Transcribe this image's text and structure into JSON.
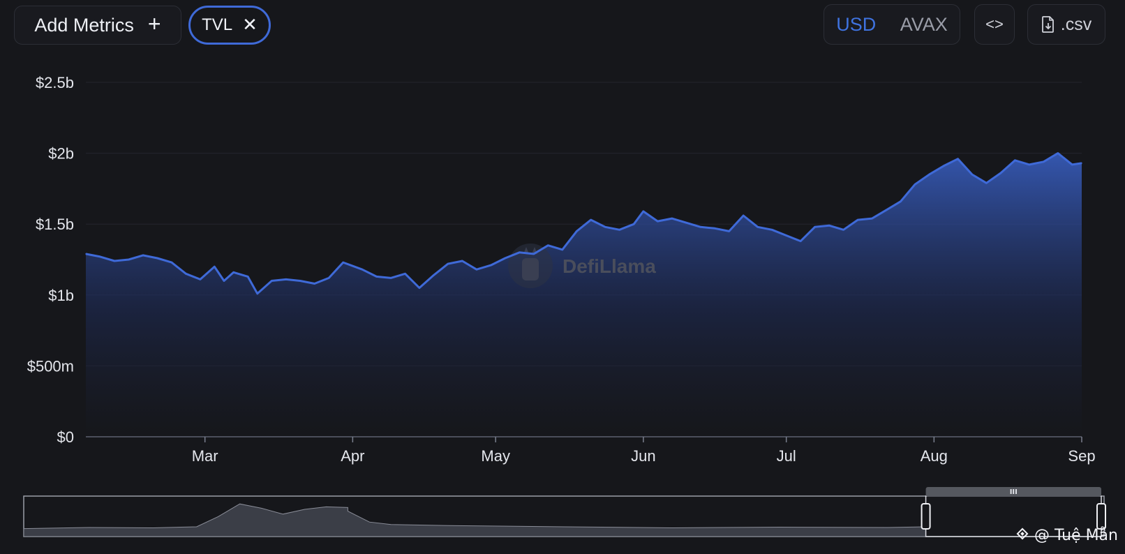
{
  "toolbar": {
    "add_metrics_label": "Add Metrics",
    "add_metrics_icon": "+",
    "metric_chip_label": "TVL",
    "metric_chip_close": "✕",
    "currency_options": [
      "USD",
      "AVAX"
    ],
    "currency_selected": "USD",
    "embed_icon": "<>",
    "csv_label": ".csv"
  },
  "watermark": "DefiLlama",
  "credit": "@ Tuệ Mẫn",
  "colors": {
    "line": "#3f6ad8",
    "accent": "#3f73e0",
    "background": "#16171b"
  },
  "chart_data": {
    "type": "area",
    "title": "",
    "xlabel": "",
    "ylabel": "",
    "ylim": [
      0,
      2500000000
    ],
    "y_ticks": [
      {
        "value": 0,
        "label": "$0"
      },
      {
        "value": 500000000,
        "label": "$500m"
      },
      {
        "value": 1000000000,
        "label": "$1b"
      },
      {
        "value": 1500000000,
        "label": "$1.5b"
      },
      {
        "value": 2000000000,
        "label": "$2b"
      },
      {
        "value": 2500000000,
        "label": "$2.5b"
      }
    ],
    "x_range": [
      "2024-02-05",
      "2024-09-01"
    ],
    "x_ticks": [
      {
        "date": "2024-03-01",
        "label": "Mar"
      },
      {
        "date": "2024-04-01",
        "label": "Apr"
      },
      {
        "date": "2024-05-01",
        "label": "May"
      },
      {
        "date": "2024-06-01",
        "label": "Jun"
      },
      {
        "date": "2024-07-01",
        "label": "Jul"
      },
      {
        "date": "2024-08-01",
        "label": "Aug"
      },
      {
        "date": "2024-09-01",
        "label": "Sep"
      }
    ],
    "series": [
      {
        "values": [
          [
            "2024-02-05",
            1290000000
          ],
          [
            "2024-02-08",
            1270000000
          ],
          [
            "2024-02-11",
            1240000000
          ],
          [
            "2024-02-14",
            1250000000
          ],
          [
            "2024-02-17",
            1280000000
          ],
          [
            "2024-02-20",
            1260000000
          ],
          [
            "2024-02-23",
            1230000000
          ],
          [
            "2024-02-26",
            1150000000
          ],
          [
            "2024-02-29",
            1110000000
          ],
          [
            "2024-03-03",
            1200000000
          ],
          [
            "2024-03-05",
            1100000000
          ],
          [
            "2024-03-07",
            1160000000
          ],
          [
            "2024-03-10",
            1130000000
          ],
          [
            "2024-03-12",
            1010000000
          ],
          [
            "2024-03-15",
            1100000000
          ],
          [
            "2024-03-18",
            1110000000
          ],
          [
            "2024-03-21",
            1100000000
          ],
          [
            "2024-03-24",
            1080000000
          ],
          [
            "2024-03-27",
            1120000000
          ],
          [
            "2024-03-30",
            1230000000
          ],
          [
            "2024-04-03",
            1180000000
          ],
          [
            "2024-04-06",
            1130000000
          ],
          [
            "2024-04-09",
            1120000000
          ],
          [
            "2024-04-12",
            1150000000
          ],
          [
            "2024-04-15",
            1050000000
          ],
          [
            "2024-04-18",
            1140000000
          ],
          [
            "2024-04-21",
            1220000000
          ],
          [
            "2024-04-24",
            1240000000
          ],
          [
            "2024-04-27",
            1180000000
          ],
          [
            "2024-04-30",
            1210000000
          ],
          [
            "2024-05-03",
            1260000000
          ],
          [
            "2024-05-06",
            1300000000
          ],
          [
            "2024-05-09",
            1290000000
          ],
          [
            "2024-05-12",
            1350000000
          ],
          [
            "2024-05-15",
            1320000000
          ],
          [
            "2024-05-18",
            1450000000
          ],
          [
            "2024-05-21",
            1530000000
          ],
          [
            "2024-05-24",
            1480000000
          ],
          [
            "2024-05-27",
            1460000000
          ],
          [
            "2024-05-30",
            1500000000
          ],
          [
            "2024-06-01",
            1590000000
          ],
          [
            "2024-06-04",
            1520000000
          ],
          [
            "2024-06-07",
            1540000000
          ],
          [
            "2024-06-10",
            1510000000
          ],
          [
            "2024-06-13",
            1480000000
          ],
          [
            "2024-06-16",
            1470000000
          ],
          [
            "2024-06-19",
            1450000000
          ],
          [
            "2024-06-22",
            1560000000
          ],
          [
            "2024-06-25",
            1480000000
          ],
          [
            "2024-06-28",
            1460000000
          ],
          [
            "2024-07-01",
            1420000000
          ],
          [
            "2024-07-04",
            1380000000
          ],
          [
            "2024-07-07",
            1480000000
          ],
          [
            "2024-07-10",
            1490000000
          ],
          [
            "2024-07-13",
            1460000000
          ],
          [
            "2024-07-16",
            1530000000
          ],
          [
            "2024-07-19",
            1540000000
          ],
          [
            "2024-07-22",
            1600000000
          ],
          [
            "2024-07-25",
            1660000000
          ],
          [
            "2024-07-28",
            1780000000
          ],
          [
            "2024-07-31",
            1850000000
          ],
          [
            "2024-08-03",
            1910000000
          ],
          [
            "2024-08-06",
            1960000000
          ],
          [
            "2024-08-09",
            1850000000
          ],
          [
            "2024-08-12",
            1790000000
          ],
          [
            "2024-08-15",
            1860000000
          ],
          [
            "2024-08-18",
            1950000000
          ],
          [
            "2024-08-21",
            1920000000
          ],
          [
            "2024-08-24",
            1940000000
          ],
          [
            "2024-08-27",
            2000000000
          ],
          [
            "2024-08-30",
            1920000000
          ],
          [
            "2024-09-01",
            1930000000
          ]
        ]
      }
    ],
    "grid": true,
    "legend": "none"
  },
  "navigator": {
    "type": "area",
    "selection": [
      0.835,
      1.0
    ],
    "handle_icon": "III"
  }
}
